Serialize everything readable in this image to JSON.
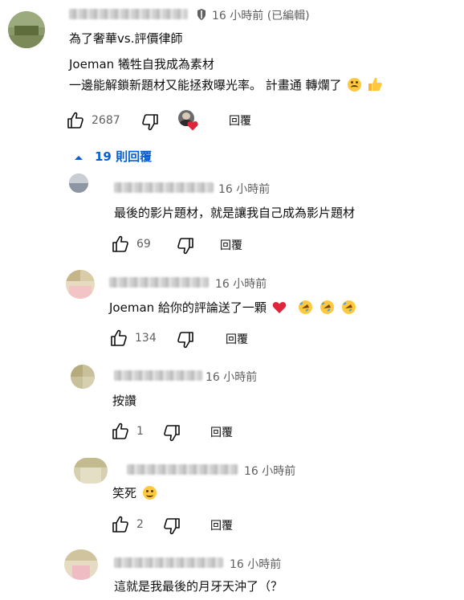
{
  "comment": {
    "timestamp": "16 小時前 (已編輯)",
    "lines": [
      "為了奢華vs.評價律師",
      "Joeman 犧牲自我成為素材",
      "一邊能解鎖新題材又能拯救曝光率。 計畫通 轉爛了"
    ],
    "likes": "2687",
    "reply_label": "回覆",
    "replies_toggle": "19 則回覆"
  },
  "replies": [
    {
      "timestamp": "16 小時前",
      "text": "最後的影片題材，就是讓我自己成為影片題材",
      "likes": "69",
      "reply_label": "回覆"
    },
    {
      "timestamp": "16 小時前",
      "text": "Joeman 給你的評論送了一顆",
      "likes": "134",
      "reply_label": "回覆"
    },
    {
      "timestamp": "16 小時前",
      "text": "按讚",
      "likes": "1",
      "reply_label": "回覆"
    },
    {
      "timestamp": "16 小時前",
      "text": "笑死",
      "likes": "2",
      "reply_label": "回覆"
    },
    {
      "timestamp": "16 小時前",
      "text": "這就是我最後的月牙天沖了（？"
    }
  ],
  "colors": {
    "link": "#065fd4",
    "heart": "#e0243a",
    "meta": "#606060"
  },
  "icons": [
    "like-icon",
    "dislike-icon",
    "creator-heart-icon",
    "chevron-up-icon",
    "pin-icon",
    "heart-emoji",
    "rofl-emoji",
    "smile-emoji",
    "thumbs-up-emoji"
  ]
}
